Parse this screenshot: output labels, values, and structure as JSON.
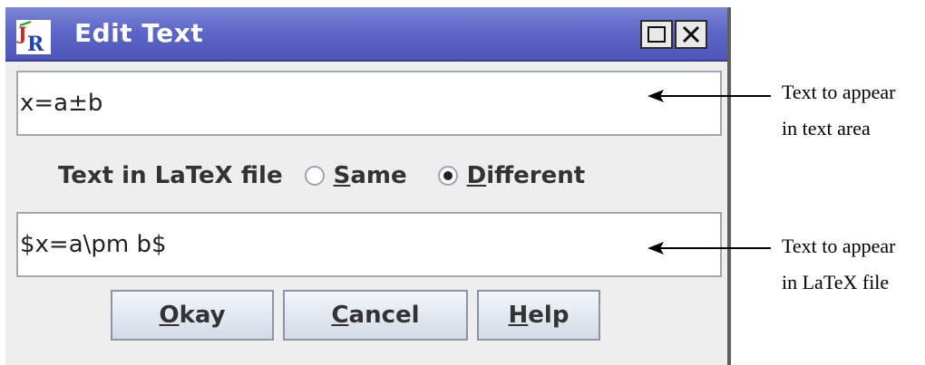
{
  "window": {
    "title": "Edit Text",
    "icon": "latex-app-icon"
  },
  "text_area_field": {
    "value": "x=a±b"
  },
  "radio_group": {
    "label": "Text in LaTeX file",
    "options": [
      {
        "mnemonic": "S",
        "rest": "ame",
        "checked": false
      },
      {
        "mnemonic": "D",
        "rest": "ifferent",
        "checked": true
      }
    ]
  },
  "latex_field": {
    "value": "$x=a\\pm b$"
  },
  "buttons": {
    "okay": {
      "mnemonic": "O",
      "rest": "kay"
    },
    "cancel": {
      "mnemonic": "C",
      "rest": "ancel"
    },
    "help": {
      "mnemonic": "H",
      "rest": "elp"
    }
  },
  "annotations": {
    "text_area": [
      "Text to appear",
      "in text area"
    ],
    "latex_file": [
      "Text to appear",
      "in LaTeX file"
    ]
  }
}
